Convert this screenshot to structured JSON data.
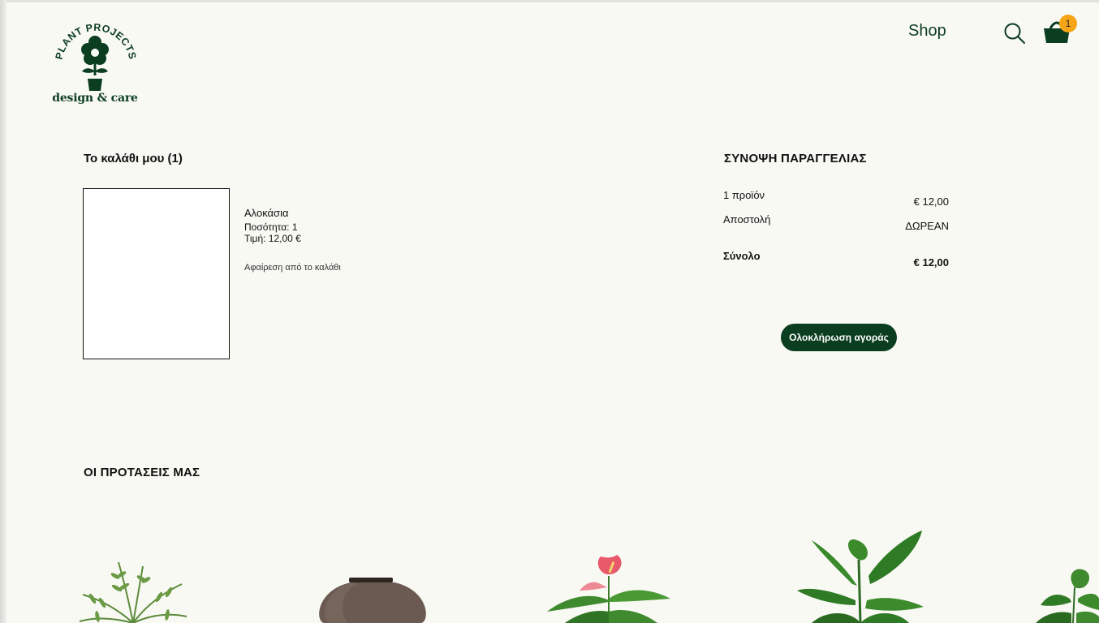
{
  "header": {
    "logo": {
      "arc_text": "PLANT PROJECTS",
      "tagline": "design & care"
    },
    "nav_shop": "Shop",
    "cart_count": "1"
  },
  "cart": {
    "title": "Το καλάθι μου (1)",
    "item": {
      "name": "Αλοκάσια",
      "quantity": "Ποσότητα: 1",
      "price": "Τιμή: 12,00 €",
      "remove": "Αφαίρεση από το καλάθι"
    }
  },
  "summary": {
    "title": "ΣΥΝΟΨΗ ΠΑΡΑΓΓΕΛΙΑΣ",
    "rows": [
      {
        "label": "1 προϊόν",
        "value": "€ 12,00"
      },
      {
        "label": "Αποστολή",
        "value": "ΔΩΡΕΑΝ"
      },
      {
        "label": "Σύνολο",
        "value": "€ 12,00"
      }
    ],
    "checkout_button": "Ολοκλήρωση αγοράς"
  },
  "recommendations": {
    "title": "ΟΙ ΠΡΟΤΑΣΕΙΣ ΜΑΣ",
    "items": [
      {
        "icon": "fern-plant-icon"
      },
      {
        "icon": "ceramic-pot-icon"
      },
      {
        "icon": "anthurium-plant-icon"
      },
      {
        "icon": "strelitzia-plant-icon"
      },
      {
        "icon": "leafy-plant-icon"
      }
    ]
  },
  "colors": {
    "background": "#f9f9f4",
    "brand_green": "#0b3d20",
    "badge": "#f5a516"
  }
}
